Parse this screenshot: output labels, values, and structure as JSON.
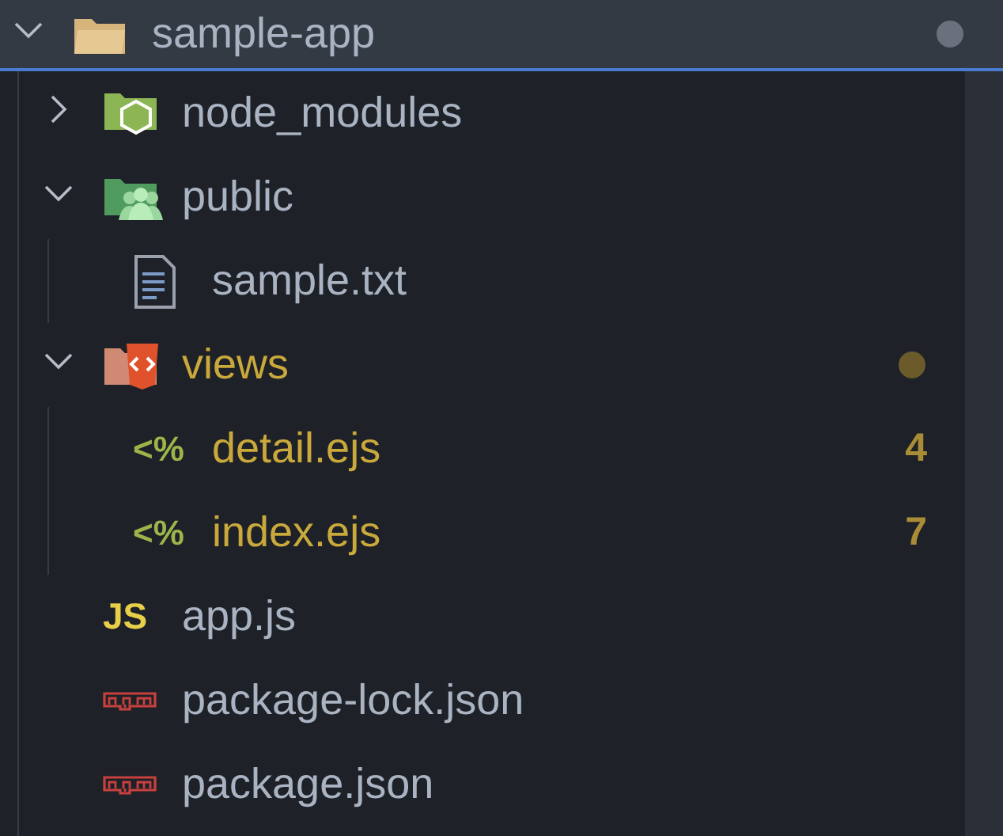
{
  "root": {
    "name": "sample-app",
    "expanded": true,
    "selected": true,
    "dot": true,
    "modified": false,
    "kind": "folder",
    "children": [
      {
        "kind": "node-folder",
        "name": "node_modules",
        "expanded": false,
        "modified": false
      },
      {
        "kind": "public-folder",
        "name": "public",
        "expanded": true,
        "modified": false,
        "children": [
          {
            "kind": "text",
            "name": "sample.txt",
            "modified": false
          }
        ]
      },
      {
        "kind": "views-folder",
        "name": "views",
        "expanded": true,
        "modified": true,
        "dot": true,
        "children": [
          {
            "kind": "ejs",
            "name": "detail.ejs",
            "glyph": "<%",
            "modified": true,
            "badge": "4"
          },
          {
            "kind": "ejs",
            "name": "index.ejs",
            "glyph": "<%",
            "modified": true,
            "badge": "7"
          }
        ]
      },
      {
        "kind": "js",
        "name": "app.js",
        "glyph": "JS",
        "modified": false
      },
      {
        "kind": "npm",
        "name": "package-lock.json",
        "modified": false
      },
      {
        "kind": "npm",
        "name": "package.json",
        "modified": false
      }
    ]
  }
}
